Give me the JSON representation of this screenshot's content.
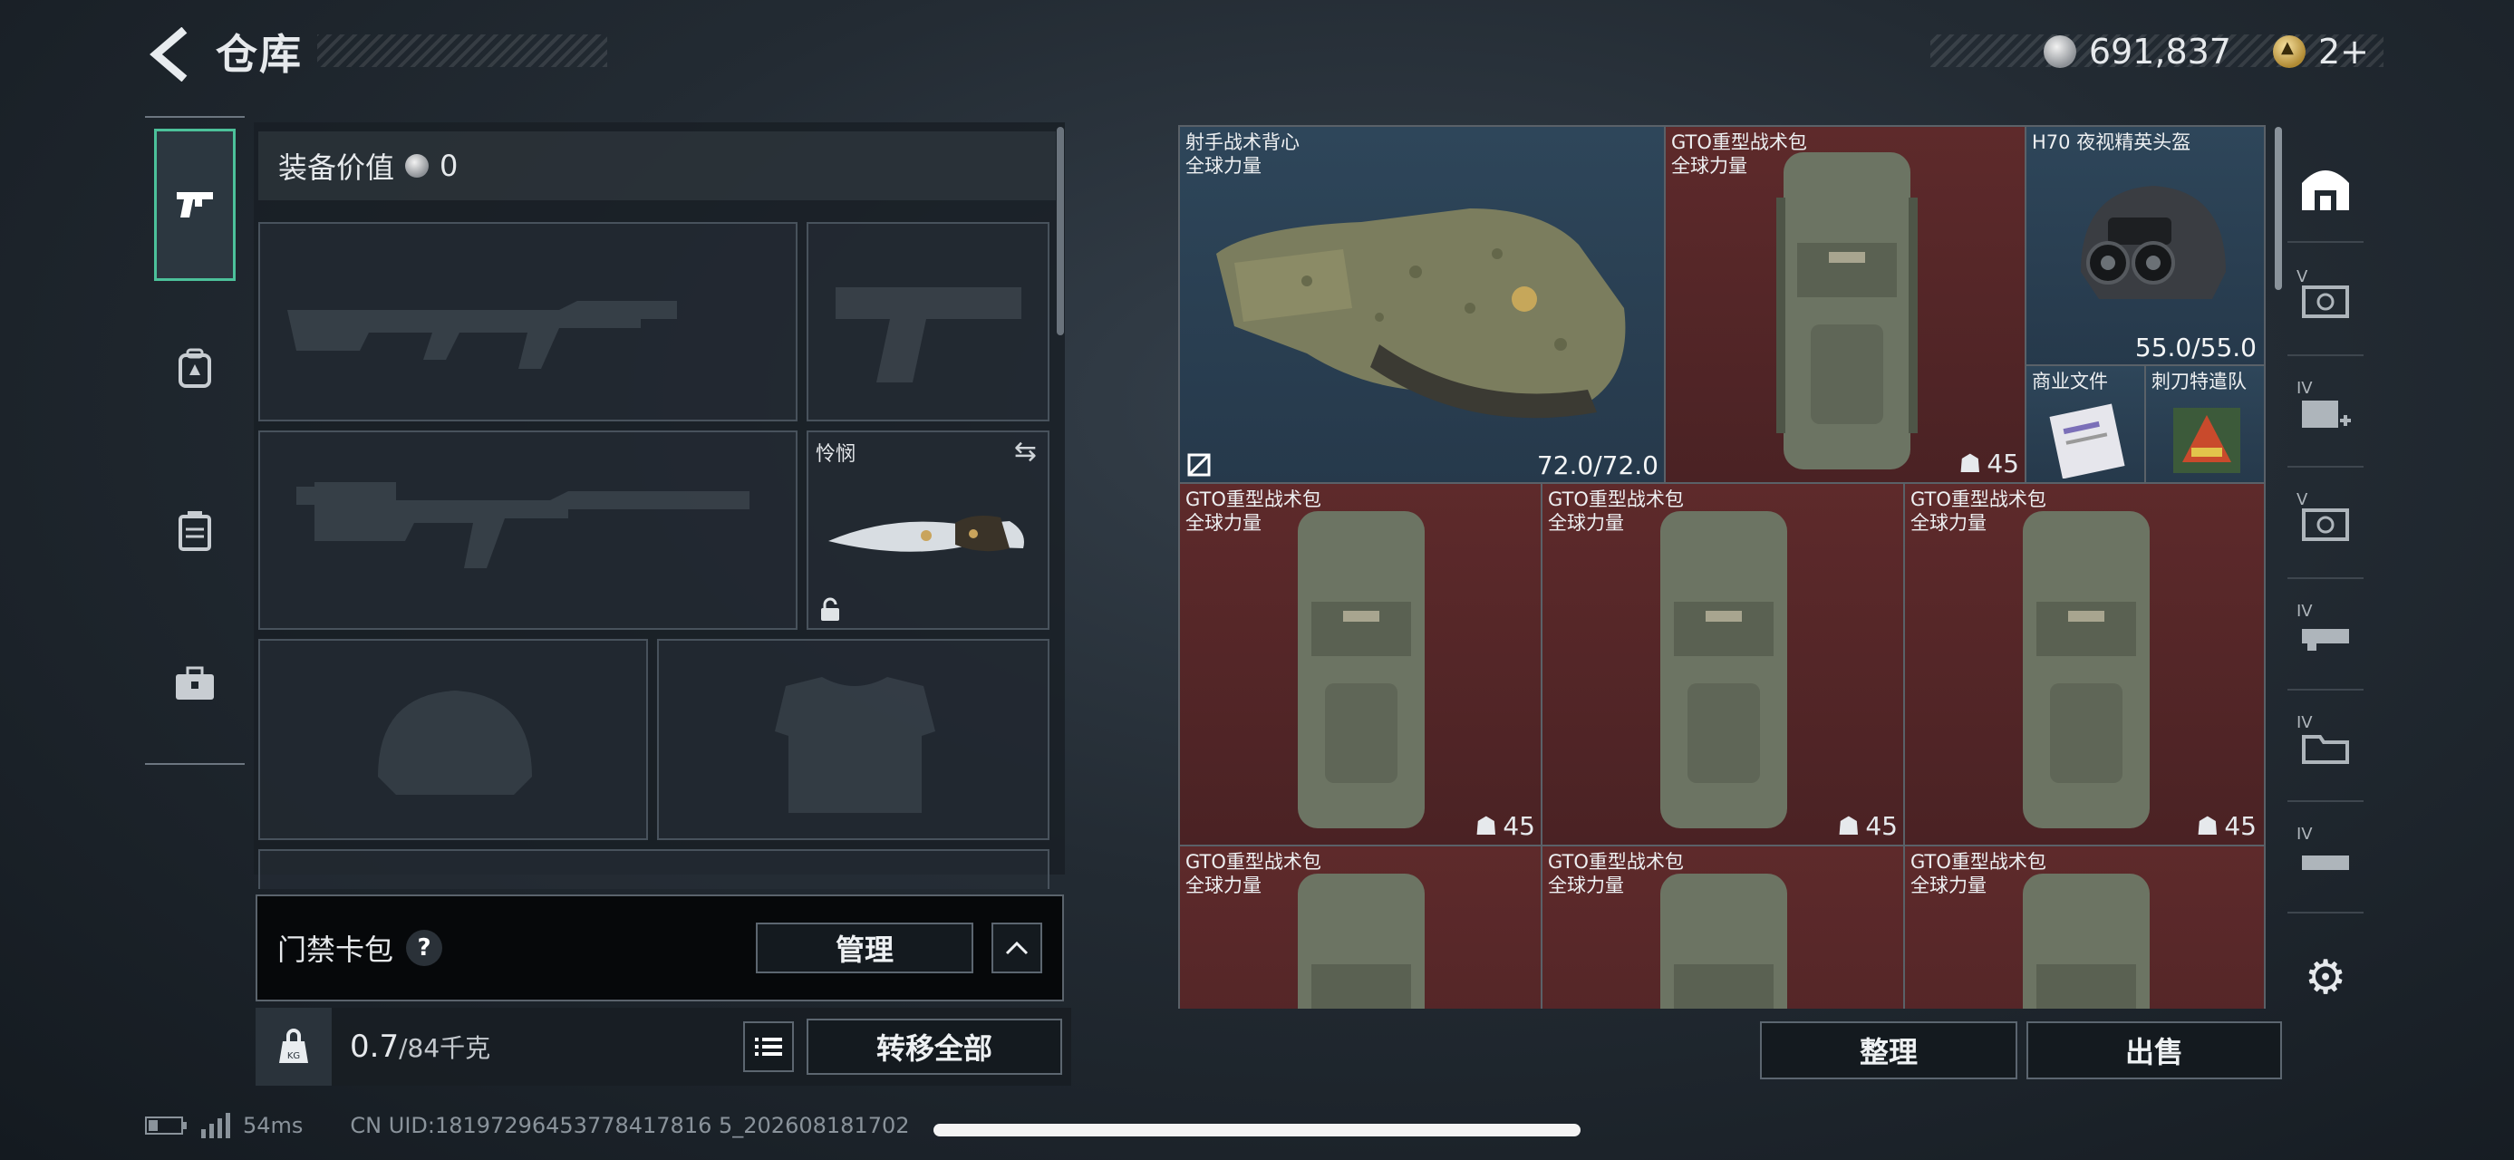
{
  "header": {
    "title": "仓库",
    "currency_amount": "691,837",
    "premium_amount": "2+"
  },
  "loadout": {
    "equip_value_label": "装备价值",
    "equip_value": "0",
    "melee_slot_name": "怜悯",
    "card_pack_label": "门禁卡包",
    "help_glyph": "?",
    "manage_label": "管理",
    "weight_current": "0.7",
    "weight_max": "/84千克",
    "transfer_all_label": "转移全部"
  },
  "inventory": {
    "items": [
      {
        "name": "射手战术背心",
        "faction": "全球力量",
        "value": "72.0/72.0",
        "style": "blue"
      },
      {
        "name": "GTO重型战术包",
        "faction": "全球力量",
        "level": "45",
        "style": "red"
      },
      {
        "name": "H70 夜视精英头盔",
        "faction": "",
        "value": "55.0/55.0",
        "style": "blue"
      },
      {
        "name": "商业文件",
        "faction": "",
        "style": "blue"
      },
      {
        "name": "刺刀特遣队",
        "faction": "",
        "style": "blue"
      },
      {
        "name": "GTO重型战术包",
        "faction": "全球力量",
        "level": "45",
        "style": "red"
      },
      {
        "name": "GTO重型战术包",
        "faction": "全球力量",
        "level": "45",
        "style": "red"
      },
      {
        "name": "GTO重型战术包",
        "faction": "全球力量",
        "level": "45",
        "style": "red"
      },
      {
        "name": "GTO重型战术包",
        "faction": "全球力量",
        "style": "red"
      },
      {
        "name": "GTO重型战术包",
        "faction": "全球力量",
        "style": "red"
      },
      {
        "name": "GTO重型战术包",
        "faction": "全球力量",
        "style": "red"
      }
    ],
    "sort_label": "整理",
    "sell_label": "出售"
  },
  "right_nav": {
    "tiers": [
      "V",
      "IV",
      "V",
      "IV",
      "IV",
      "IV"
    ]
  },
  "status": {
    "ping": "54ms",
    "uid": "CN UID:18197296453778417816 5_202608181702"
  },
  "colors": {
    "accent": "#4cc19a",
    "item_red": "#5e2a2b",
    "item_blue": "#2e465a"
  }
}
